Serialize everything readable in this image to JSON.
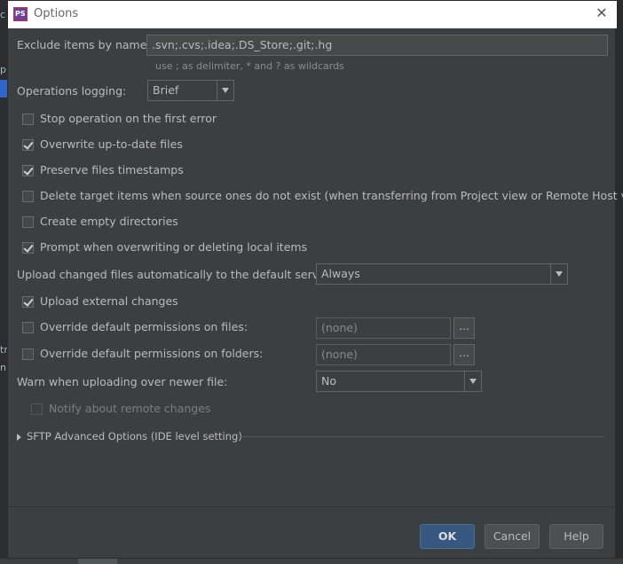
{
  "dialog": {
    "title": "Options"
  },
  "exclude": {
    "label": "Exclude items by name:",
    "value": ".svn;.cvs;.idea;.DS_Store;.git;.hg",
    "hint": "use ; as delimiter, * and ? as wildcards"
  },
  "logging": {
    "label": "Operations logging:",
    "value": "Brief"
  },
  "options": [
    {
      "label": "Stop operation on the first error",
      "checked": false
    },
    {
      "label": "Overwrite up-to-date files",
      "checked": true
    },
    {
      "label": "Preserve files timestamps",
      "checked": true
    },
    {
      "label": "Delete target items when source ones do not exist (when transferring from Project view or Remote Host view)",
      "checked": false
    },
    {
      "label": "Create empty directories",
      "checked": false
    },
    {
      "label": "Prompt when overwriting or deleting local items",
      "checked": true
    }
  ],
  "upload_auto": {
    "label": "Upload changed files automatically to the default server",
    "value": "Always"
  },
  "upload_external": {
    "label": "Upload external changes",
    "checked": true
  },
  "perm_files": {
    "label": "Override default permissions on files:",
    "value": "(none)",
    "checked": false,
    "browse": "..."
  },
  "perm_folders": {
    "label": "Override default permissions on folders:",
    "value": "(none)",
    "checked": false,
    "browse": "..."
  },
  "warn_newer": {
    "label": "Warn when uploading over newer file:",
    "value": "No"
  },
  "notify_remote": {
    "label": "Notify about remote changes",
    "checked": false,
    "enabled": false
  },
  "sftp_section": {
    "label": "SFTP Advanced Options (IDE level setting)"
  },
  "buttons": {
    "ok": "OK",
    "cancel": "Cancel",
    "help": "Help"
  },
  "background": {
    "fragments": [
      "c",
      "p",
      "tn",
      "n"
    ]
  }
}
